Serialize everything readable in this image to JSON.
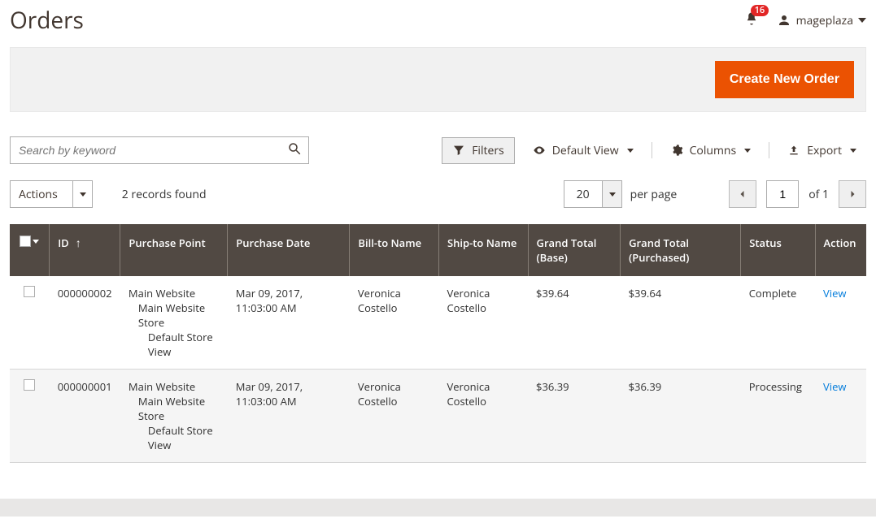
{
  "page_title": "Orders",
  "notifications_count": "16",
  "username": "mageplaza",
  "create_button": "Create New Order",
  "search_placeholder": "Search by keyword",
  "filters_label": "Filters",
  "default_view_label": "Default View",
  "columns_label": "Columns",
  "export_label": "Export",
  "actions_label": "Actions",
  "records_found": "2 records found",
  "per_page_value": "20",
  "per_page_label": "per page",
  "page_current": "1",
  "of_label": "of 1",
  "columns": {
    "id": "ID",
    "purchase_point": "Purchase Point",
    "purchase_date": "Purchase Date",
    "bill_to": "Bill-to Name",
    "ship_to": "Ship-to Name",
    "gt_base": "Grand Total (Base)",
    "gt_purchased": "Grand Total (Purchased)",
    "status": "Status",
    "action": "Action"
  },
  "view_label": "View",
  "purchase_point_lines": {
    "l1": "Main Website",
    "l2": "Main Website Store",
    "l3": "Default Store View"
  },
  "rows": [
    {
      "id": "000000002",
      "date": "Mar 09, 2017, 11:03:00 AM",
      "bill": "Veronica Costello",
      "ship": "Veronica Costello",
      "gtb": "$39.64",
      "gtp": "$39.64",
      "status": "Complete"
    },
    {
      "id": "000000001",
      "date": "Mar 09, 2017, 11:03:00 AM",
      "bill": "Veronica Costello",
      "ship": "Veronica Costello",
      "gtb": "$36.39",
      "gtp": "$36.39",
      "status": "Processing"
    }
  ]
}
